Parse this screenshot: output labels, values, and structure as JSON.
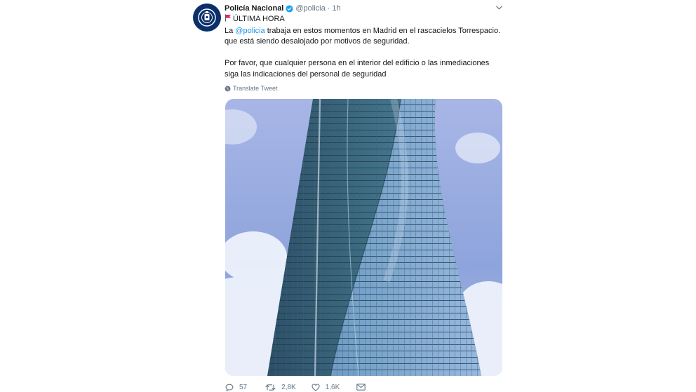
{
  "tweet": {
    "author_name": "Policía Nacional",
    "handle": "@policia",
    "separator": "·",
    "time": "1h",
    "line1": "ÚLTIMA HORA",
    "line2_prefix": "La ",
    "mention": "@policia",
    "line2_suffix": " trabaja en estos momentos en Madrid en el rascacielos Torrespacio.",
    "line3": "que está siendo desalojado por motivos de seguridad.",
    "line4": "Por favor, que cualquier persona en el interior del edificio o las inmediaciones",
    "line5": "siga las indicaciones del personal de seguridad",
    "translate_label": "Translate Tweet",
    "image_alt": "Torrespacio skyscraper"
  },
  "actions": {
    "reply_count": "57",
    "retweet_count": "2,8K",
    "like_count": "1,6K"
  },
  "colors": {
    "link": "#1b95e0",
    "secondary": "#657786",
    "verified": "#1da1f2",
    "flag": "#e0245e"
  },
  "icons": [
    "police-badge-icon",
    "verified-badge-icon",
    "chevron-down-icon",
    "red-flag-icon",
    "globe-icon",
    "reply-icon",
    "retweet-icon",
    "like-icon",
    "dm-icon"
  ]
}
